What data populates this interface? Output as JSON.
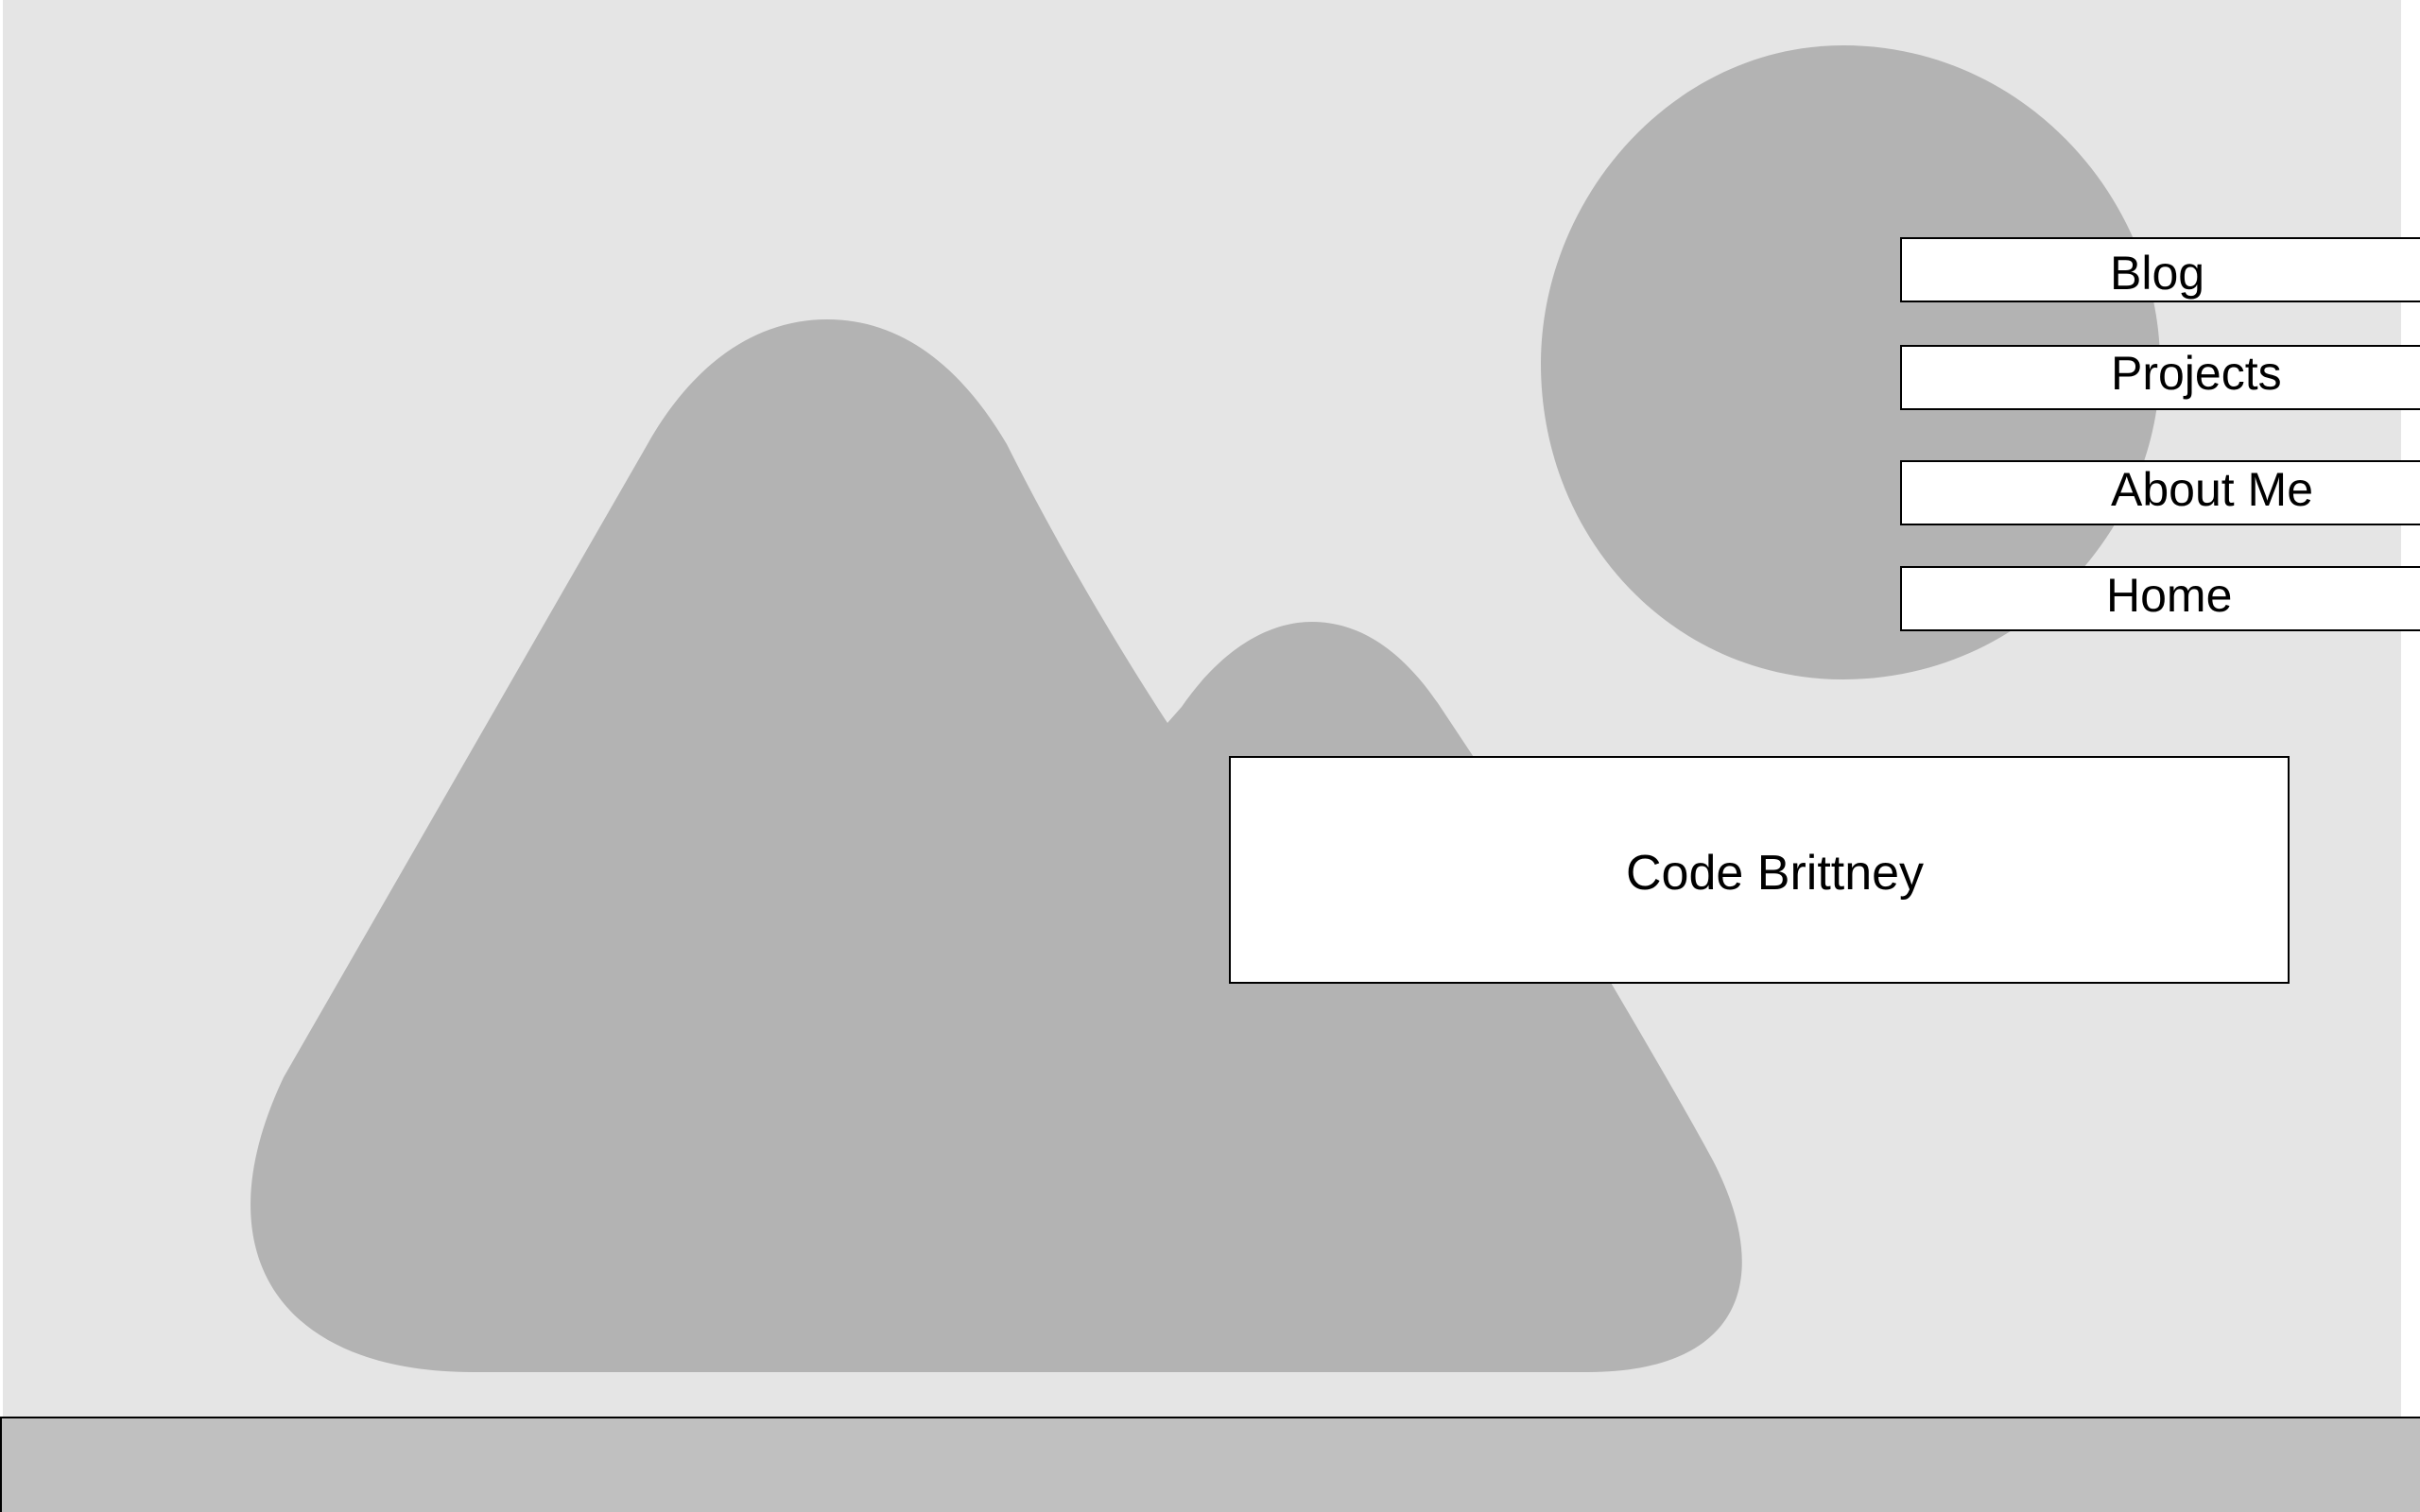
{
  "hero": {
    "image_icon": "image-placeholder-icon"
  },
  "nav": {
    "items": [
      {
        "label": "Blog"
      },
      {
        "label": "Projects"
      },
      {
        "label": "About Me"
      },
      {
        "label": "Home"
      }
    ]
  },
  "title_card": {
    "text": "Code Brittney"
  },
  "colors": {
    "hero_background": "#e5e5e5",
    "placeholder_shape": "#b3b3b3",
    "footer": "#c0c0c0",
    "box_background": "#ffffff",
    "border": "#000000"
  }
}
